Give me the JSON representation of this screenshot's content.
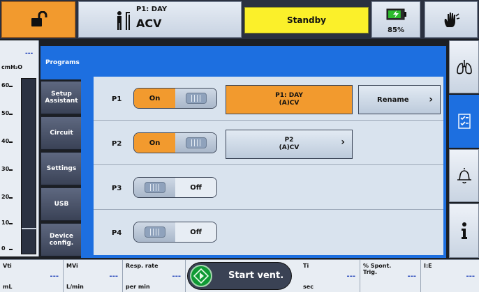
{
  "header": {
    "program_line": "P1: DAY",
    "mode": "ACV",
    "status": "Standby",
    "battery_percent": "85%",
    "battery_level": 0.85
  },
  "pressure": {
    "unit": "cmH₂O",
    "value": "---",
    "ticks": [
      "60",
      "50",
      "40",
      "30",
      "20",
      "10",
      "0"
    ]
  },
  "menu": {
    "items": [
      {
        "label": "Programs"
      },
      {
        "label": "Setup Assistant"
      },
      {
        "label": "Circuit"
      },
      {
        "label": "Settings"
      },
      {
        "label": "USB"
      },
      {
        "label": "Device config."
      }
    ]
  },
  "programs": {
    "rows": [
      {
        "id": "P1",
        "toggle": "On",
        "program_name": "P1: DAY",
        "program_mode": "(A)CV"
      },
      {
        "id": "P2",
        "toggle": "On",
        "program_name": "P2",
        "program_mode": "(A)CV"
      },
      {
        "id": "P3",
        "toggle": "Off"
      },
      {
        "id": "P4",
        "toggle": "Off"
      }
    ],
    "rename_label": "Rename"
  },
  "bottom": {
    "cells": [
      {
        "title": "Vti",
        "unit": "mL",
        "value": "---"
      },
      {
        "title": "MVi",
        "unit": "L/min",
        "value": "---"
      },
      {
        "title": "Resp. rate",
        "unit": "per min",
        "value": "---"
      },
      {
        "title": "Ti",
        "unit": "sec",
        "value": "---"
      },
      {
        "title": "% Spont. Trig.",
        "unit": "",
        "value": "---"
      },
      {
        "title": "I:E",
        "unit": "",
        "value": "---"
      }
    ],
    "start_label": "Start vent."
  },
  "colors": {
    "accent_blue": "#1d6fe0",
    "orange": "#f29a2e",
    "standby_yellow": "#fbf02a",
    "start_green": "#0f9a34",
    "value_blue": "#1d3fb8"
  },
  "icons": [
    "unlock-icon",
    "patient-icon",
    "battery-icon",
    "hand-alarm-icon",
    "lungs-icon",
    "checklist-icon",
    "bell-icon",
    "info-icon",
    "start-icon"
  ]
}
